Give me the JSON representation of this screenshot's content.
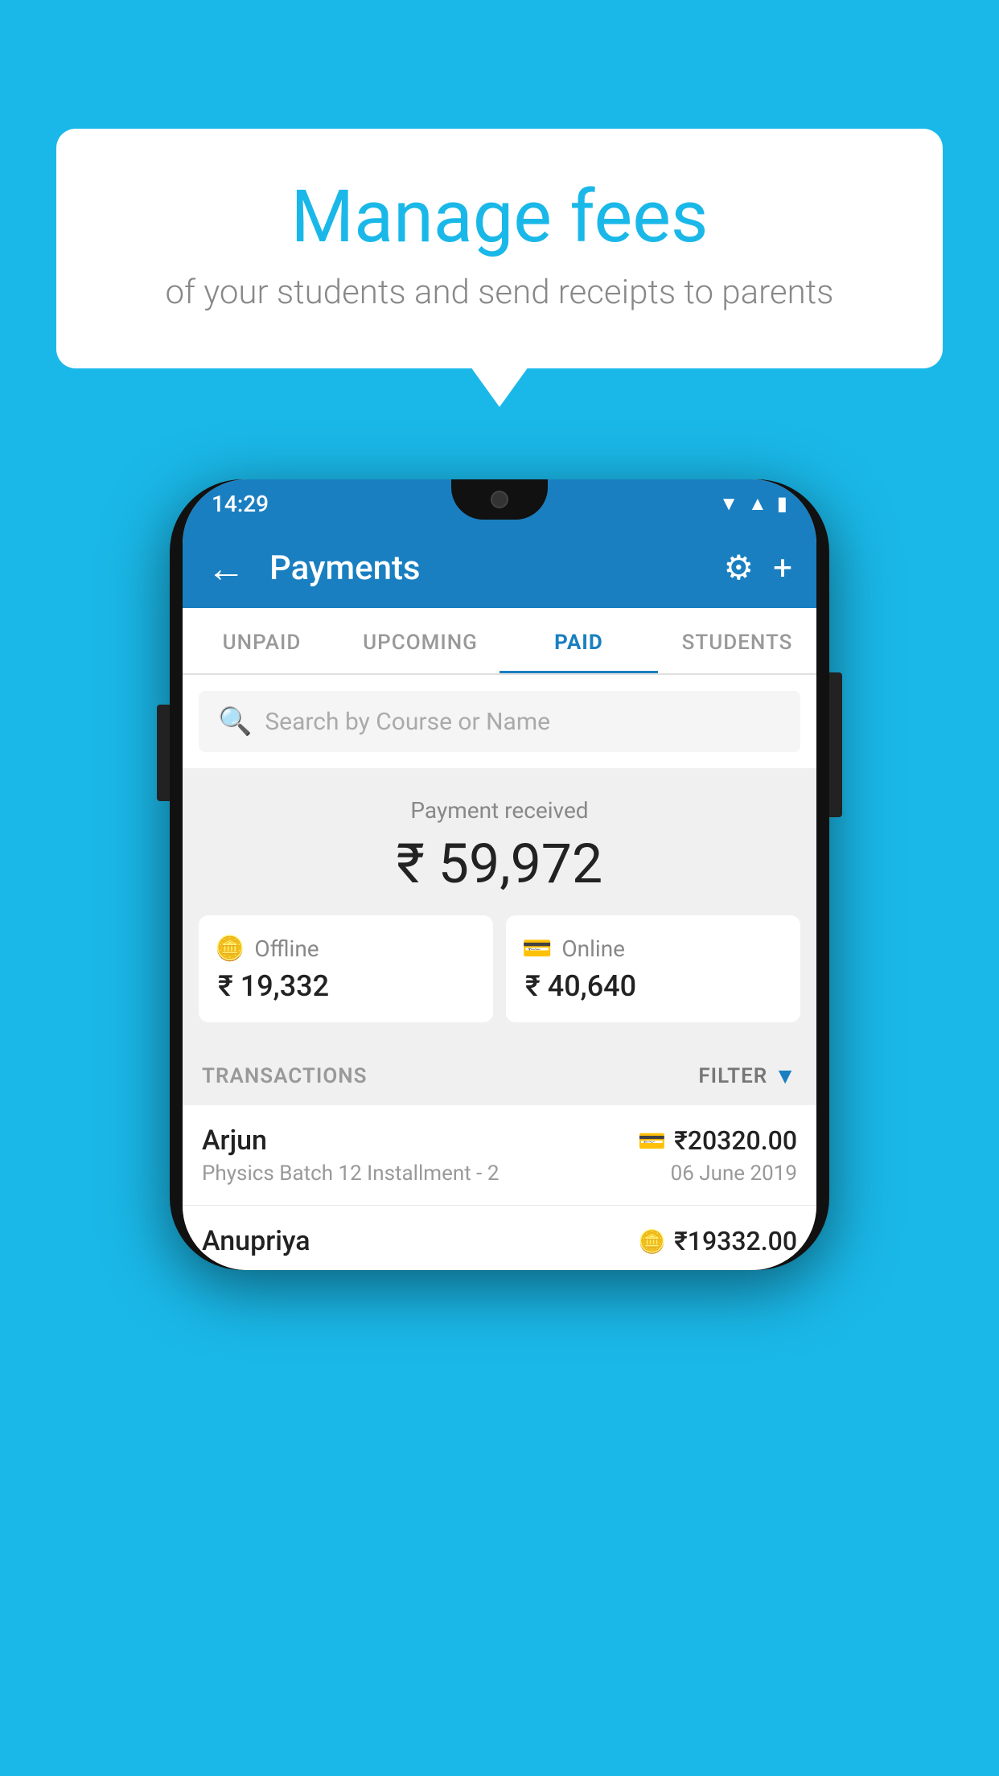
{
  "background_color": "#1ab8e8",
  "bubble": {
    "title": "Manage fees",
    "subtitle": "of your students and send receipts to parents"
  },
  "status_bar": {
    "time": "14:29"
  },
  "app_bar": {
    "title": "Payments",
    "back_label": "←",
    "gear_icon": "⚙",
    "plus_icon": "+"
  },
  "tabs": [
    {
      "label": "UNPAID",
      "active": false
    },
    {
      "label": "UPCOMING",
      "active": false
    },
    {
      "label": "PAID",
      "active": true
    },
    {
      "label": "STUDENTS",
      "active": false
    }
  ],
  "search": {
    "placeholder": "Search by Course or Name"
  },
  "payment_summary": {
    "label": "Payment received",
    "amount": "₹ 59,972",
    "offline_label": "Offline",
    "offline_amount": "₹ 19,332",
    "online_label": "Online",
    "online_amount": "₹ 40,640"
  },
  "transactions": {
    "header_label": "TRANSACTIONS",
    "filter_label": "FILTER",
    "rows": [
      {
        "name": "Arjun",
        "description": "Physics Batch 12 Installment - 2",
        "amount": "₹20320.00",
        "date": "06 June 2019",
        "icon_type": "card"
      },
      {
        "name": "Anupriya",
        "description": "",
        "amount": "₹19332.00",
        "date": "",
        "icon_type": "cash"
      }
    ]
  }
}
